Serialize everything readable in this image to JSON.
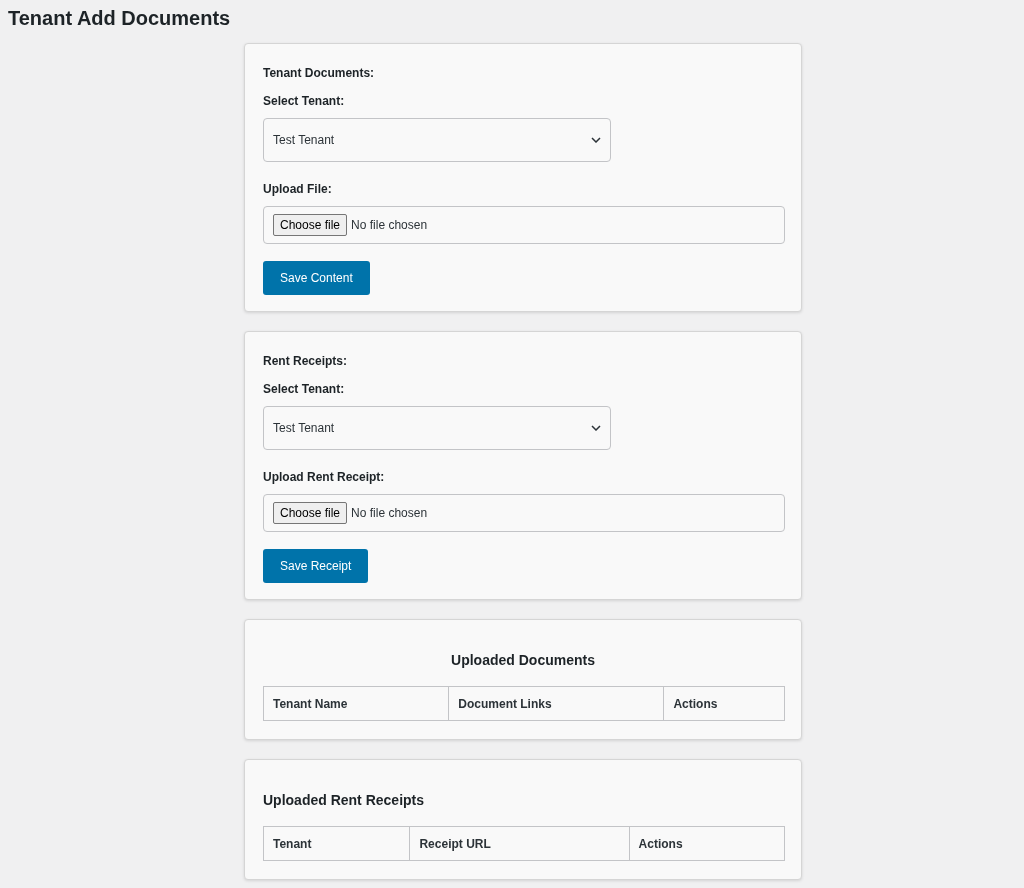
{
  "page_title": "Tenant Add Documents",
  "forms": [
    {
      "heading": "Tenant Documents:",
      "select_label": "Select Tenant:",
      "select_value": "Test Tenant",
      "file_label": "Upload File:",
      "file_button": "Choose file",
      "file_status": "No file chosen",
      "submit": "Save Content"
    },
    {
      "heading": "Rent Receipts:",
      "select_label": "Select Tenant:",
      "select_value": "Test Tenant",
      "file_label": "Upload Rent Receipt:",
      "file_button": "Choose file",
      "file_status": "No file chosen",
      "submit": "Save Receipt"
    }
  ],
  "tables": [
    {
      "title": "Uploaded Documents",
      "title_centered": true,
      "columns": [
        "Tenant Name",
        "Document Links",
        "Actions"
      ]
    },
    {
      "title": "Uploaded Rent Receipts",
      "title_centered": false,
      "columns": [
        "Tenant",
        "Receipt URL",
        "Actions"
      ]
    }
  ]
}
